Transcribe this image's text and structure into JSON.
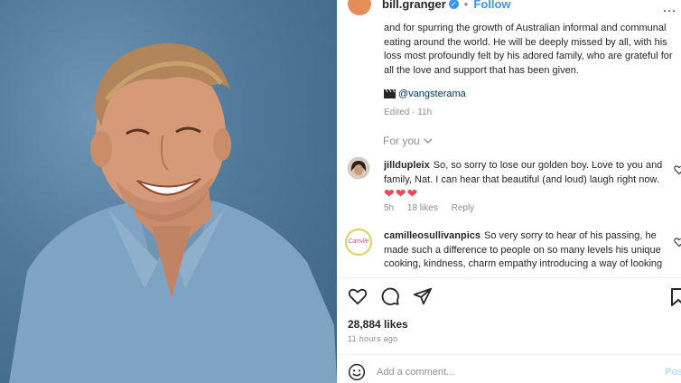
{
  "header": {
    "username": "bill.granger",
    "separator": "•",
    "follow_label": "Follow",
    "more_label": "…"
  },
  "caption": {
    "text": "and for spurring the growth of Australian informal and communal eating around the world. He will be deeply missed by all, with his loss most profoundly felt by his adored family, who are grateful for all the love and support that has been given.",
    "credit": "@vangsterama",
    "edited": "Edited · 11h"
  },
  "for_you": {
    "label": "For you"
  },
  "comments": [
    {
      "username": "jilldupleix",
      "text": "So, so sorry to lose our golden boy. Love to you and family, Nat. I can hear that beautiful (and loud) laugh right now.",
      "hearts": "❤❤❤",
      "time": "5h",
      "likes": "18 likes",
      "reply": "Reply"
    },
    {
      "username": "camilleosullivanpics",
      "text": "So very sorry to hear of his passing, he made such a difference to people on so many levels his unique cooking, kindness, charm empathy introducing a way of looking",
      "avatar_label": "Camille"
    }
  ],
  "stats": {
    "likes": "28,884 likes",
    "ago": "11 hours ago"
  },
  "composer": {
    "placeholder": "Add a comment...",
    "post_label": "Post"
  },
  "colors": {
    "accent": "#3897f0",
    "heart": "#ed4956",
    "photo_bg": "#4f7899"
  },
  "icons": [
    "verified-badge-icon",
    "clapperboard-icon",
    "chevron-down-icon",
    "heart-icon",
    "comment-icon",
    "share-icon",
    "bookmark-icon",
    "emoji-icon"
  ]
}
